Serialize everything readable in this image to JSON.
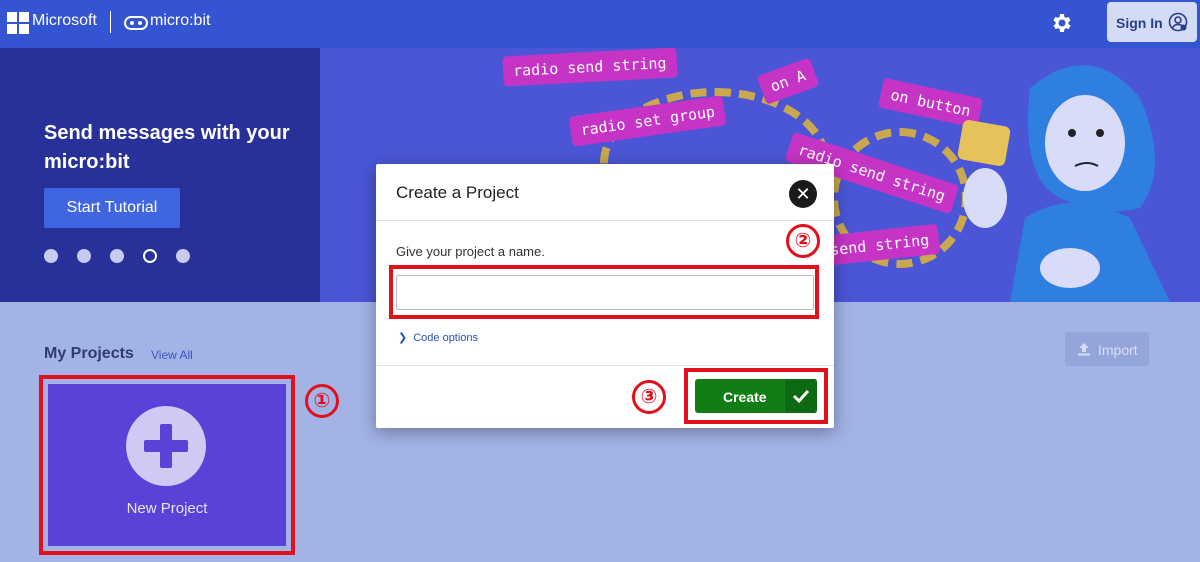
{
  "header": {
    "brand": "Microsoft",
    "product": "micro:bit",
    "signin_label": "Sign In"
  },
  "hero": {
    "title": "Send messages with your micro:bit",
    "start_button": "Start Tutorial",
    "carousel_dot_count": 5,
    "carousel_active_index": 4,
    "code_blocks": [
      "radio send string",
      "radio set group",
      "radio send string",
      "on button",
      "send string",
      "on A"
    ]
  },
  "projects": {
    "title": "My Projects",
    "view_all": "View All",
    "import_label": "Import",
    "new_project_label": "New Project"
  },
  "dialog": {
    "title": "Create a Project",
    "close_glyph": "✕",
    "prompt": "Give your project a name.",
    "name_value": "",
    "code_options": "Code options",
    "create_label": "Create"
  },
  "annotations": {
    "step1": "①",
    "step2": "②",
    "step3": "③",
    "color": "#e1101c"
  },
  "colors": {
    "topbar": "#3454d1",
    "new_project_tile": "#5842d7",
    "create_button": "#127c17"
  }
}
